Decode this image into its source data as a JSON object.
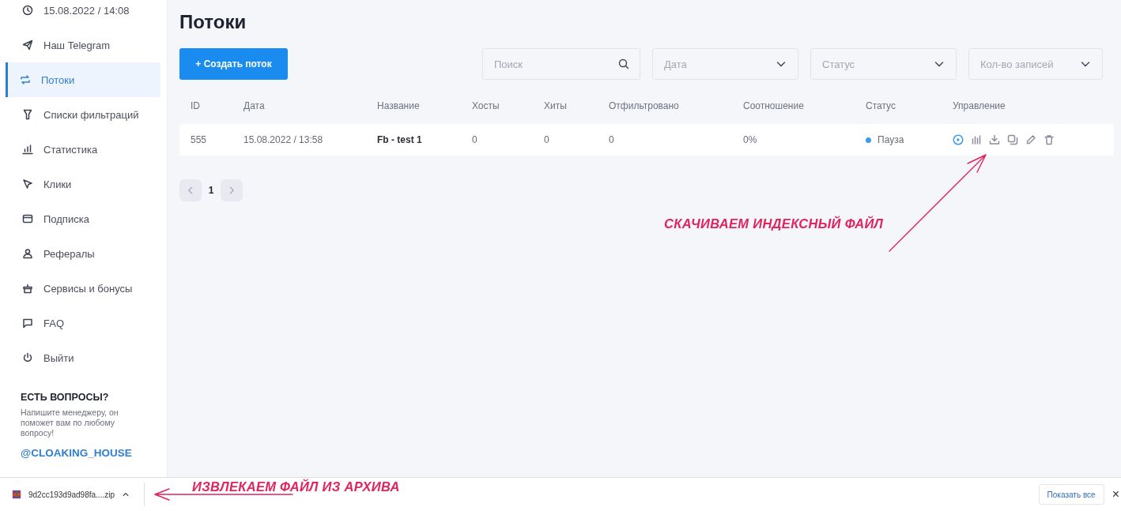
{
  "sidebar": {
    "datetime": "15.08.2022 / 14:08",
    "items": [
      {
        "label": "Наш Telegram",
        "selected": false
      },
      {
        "label": "Потоки",
        "selected": true
      },
      {
        "label": "Списки фильтраций",
        "selected": false
      },
      {
        "label": "Статистика",
        "selected": false
      },
      {
        "label": "Клики",
        "selected": false
      },
      {
        "label": "Подписка",
        "selected": false
      },
      {
        "label": "Рефералы",
        "selected": false
      },
      {
        "label": "Сервисы и бонусы",
        "selected": false
      },
      {
        "label": "FAQ",
        "selected": false
      },
      {
        "label": "Выйти",
        "selected": false
      }
    ],
    "help": {
      "title": "ЕСТЬ ВОПРОСЫ?",
      "text": "Напишите менеджеру, он поможет вам по любому вопросу!",
      "handle": "@CLOAKING_HOUSE"
    }
  },
  "page": {
    "title": "Потоки",
    "create_button": "+ Создать поток",
    "search": {
      "placeholder": "Поиск"
    },
    "filters": [
      {
        "placeholder": "Дата"
      },
      {
        "placeholder": "Статус"
      },
      {
        "placeholder": "Кол-во записей"
      }
    ]
  },
  "table": {
    "columns": [
      "ID",
      "Дата",
      "Название",
      "Хосты",
      "Хиты",
      "Отфильтровано",
      "Соотношение",
      "Статус",
      "Управление"
    ],
    "rows": [
      {
        "id": "555",
        "date": "15.08.2022 / 13:58",
        "name": "Fb - test 1",
        "hosts": "0",
        "hits": "0",
        "filtered": "0",
        "ratio": "0%",
        "status": {
          "label": "Пауза",
          "color": "#3d9be9"
        }
      }
    ]
  },
  "pagination": {
    "pages": [
      {
        "label": "1",
        "selected": true
      }
    ]
  },
  "download_bar": {
    "filename": "9d2cc193d9ad98fa....zip",
    "show_all": "Показать все",
    "close": "×"
  },
  "annotations": [
    {
      "text": "СКАЧИВАЕМ ИНДЕКСНЫЙ ФАЙЛ"
    },
    {
      "text": "ИЗВЛЕКАЕМ ФАЙЛ ИЗ АРХИВА"
    }
  ]
}
